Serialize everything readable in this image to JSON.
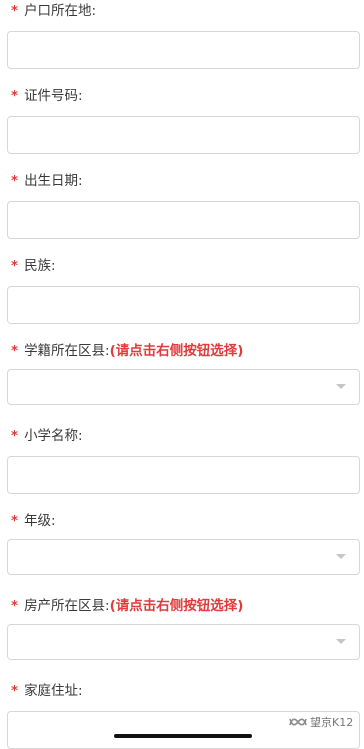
{
  "required_mark": "*",
  "fields": [
    {
      "label": "户口所在地:",
      "hint": "",
      "type": "input"
    },
    {
      "label": "证件号码:",
      "hint": "",
      "type": "input"
    },
    {
      "label": "出生日期:",
      "hint": "",
      "type": "input"
    },
    {
      "label": "民族:",
      "hint": "",
      "type": "input"
    },
    {
      "label": "学籍所在区县:",
      "hint": "(请点击右侧按钮选择)",
      "type": "select"
    },
    {
      "label": "小学名称:",
      "hint": "",
      "type": "input"
    },
    {
      "label": "年级:",
      "hint": "",
      "type": "select"
    },
    {
      "label": "房产所在区县:",
      "hint": "(请点击右侧按钮选择)",
      "type": "select"
    },
    {
      "label": "家庭住址:",
      "hint": "",
      "type": "input"
    }
  ],
  "watermark": {
    "text": "望京K12",
    "icon": "wechat-channel-icon"
  },
  "colors": {
    "required": "#e23a3a",
    "border": "#d7d7d7",
    "text": "#3a3a3a"
  }
}
